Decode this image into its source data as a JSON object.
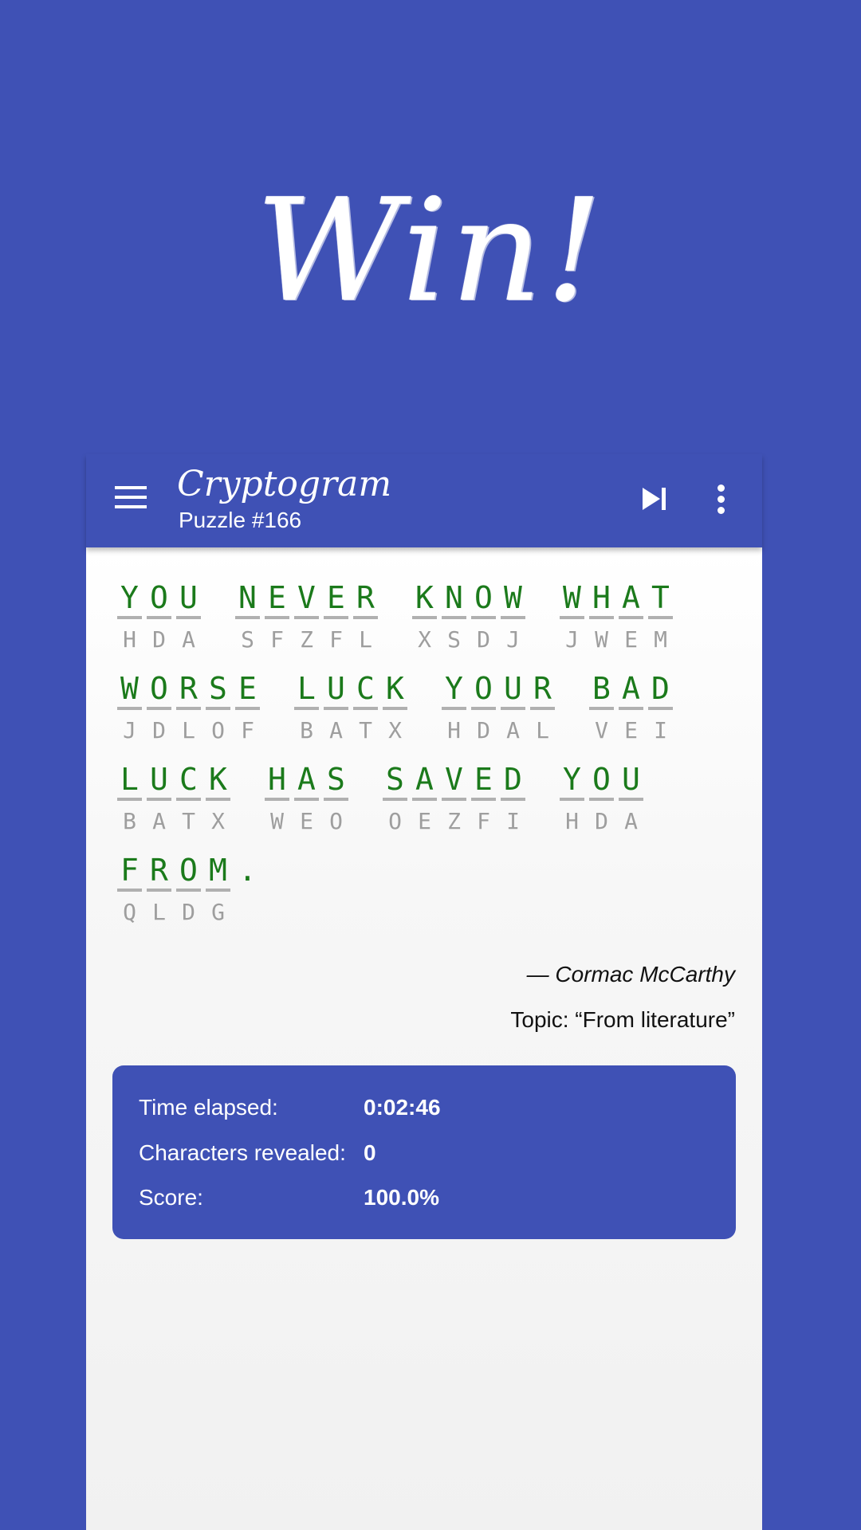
{
  "banner": {
    "title": "Win!"
  },
  "app_bar": {
    "title": "Cryptogram",
    "subtitle": "Puzzle #166",
    "menu_icon": "menu-icon",
    "skip_icon": "skip-next-icon",
    "more_icon": "more-vert-icon"
  },
  "puzzle": {
    "lines": [
      [
        {
          "plain": "YOU",
          "cipher": "HDA"
        },
        {
          "plain": "NEVER",
          "cipher": "SFZFL"
        },
        {
          "plain": "KNOW",
          "cipher": "XSDJ"
        },
        {
          "plain": "WHAT",
          "cipher": "JWEM"
        }
      ],
      [
        {
          "plain": "WORSE",
          "cipher": "JDLOF"
        },
        {
          "plain": "LUCK",
          "cipher": "BATX"
        },
        {
          "plain": "YOUR",
          "cipher": "HDAL"
        },
        {
          "plain": "BAD",
          "cipher": "VEI"
        }
      ],
      [
        {
          "plain": "LUCK",
          "cipher": "BATX"
        },
        {
          "plain": "HAS",
          "cipher": "WEO"
        },
        {
          "plain": "SAVED",
          "cipher": "OEZFI"
        },
        {
          "plain": "YOU",
          "cipher": "HDA"
        }
      ],
      [
        {
          "plain": "FROM.",
          "cipher": "QLDG"
        }
      ]
    ],
    "author": "— Cormac McCarthy",
    "topic": "Topic: “From literature”"
  },
  "stats": {
    "time_label": "Time elapsed:",
    "time_value": "0:02:46",
    "revealed_label": "Characters revealed:",
    "revealed_value": "0",
    "score_label": "Score:",
    "score_value": "100.0%"
  },
  "colors": {
    "brand": "#3f51b5",
    "solved_letter": "#1b7a1b",
    "cipher_letter": "#9e9e9e"
  }
}
